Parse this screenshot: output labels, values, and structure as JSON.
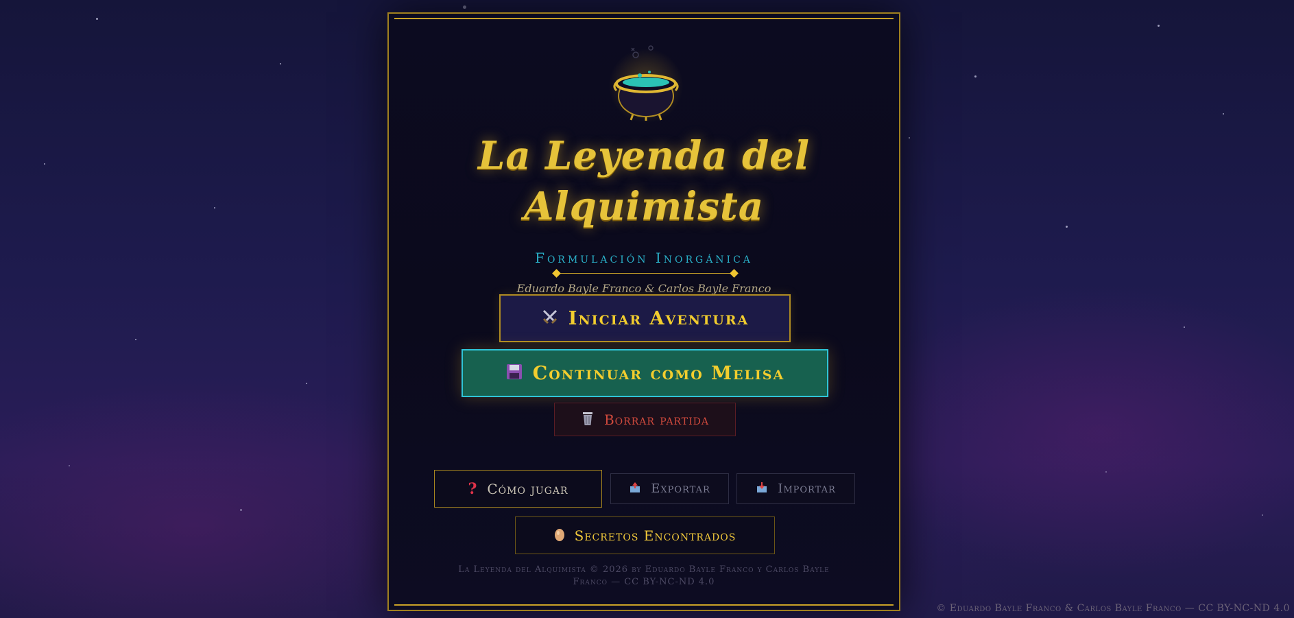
{
  "game": {
    "title_line1": "La Leyenda del",
    "title_line2": "Alquimista",
    "subtitle": "Formulación Inorgánica",
    "authors": "Eduardo Bayle Franco & Carlos Bayle Franco",
    "icon": "cauldron-icon"
  },
  "menu": {
    "start": {
      "label": "Iniciar Aventura",
      "icon": "crossed-swords-icon"
    },
    "continue": {
      "label": "Continuar como Melisa",
      "icon": "floppy-disk-icon"
    },
    "delete": {
      "label": "Borrar partida",
      "icon": "wastebasket-icon"
    },
    "howto": {
      "label": "Cómo jugar",
      "icon": "question-mark-icon"
    },
    "export": {
      "label": "Exportar",
      "icon": "outbox-icon"
    },
    "import": {
      "label": "Importar",
      "icon": "inbox-icon"
    },
    "secrets": {
      "label": "Secretos Encontrados",
      "icon": "egg-icon"
    }
  },
  "footer": {
    "license_line1": "La Leyenda del Alquimista © 2026 by Eduardo Bayle Franco y Carlos Bayle",
    "license_line2": "Franco — CC BY-NC-ND 4.0",
    "corner_credit": "© Eduardo Bayle Franco & Carlos Bayle Franco — CC BY-NC-ND 4.0"
  },
  "colors": {
    "gold": "#e6c33a",
    "teal": "#2ab0c8",
    "continue_bg": "#17614f",
    "delete_red": "#d04a3d",
    "panel_bg": "#0b0a1c"
  }
}
